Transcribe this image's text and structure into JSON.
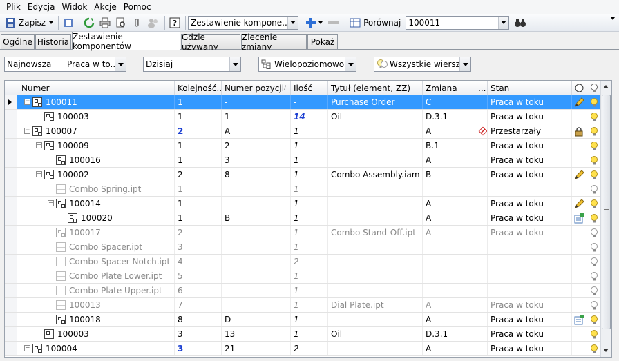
{
  "menu": [
    "Plik",
    "Edycja",
    "Widok",
    "Akcje",
    "Pomoc"
  ],
  "toolbar": {
    "save_label": "Zapisz",
    "view_combo": "Zestawienie kompone...",
    "compare_label": "Porównaj",
    "compare_value": "100011"
  },
  "tabs": [
    "Ogólne",
    "Historia",
    "Zestawienie komponentów",
    "Gdzie używany",
    "Zlecenie zmiany",
    "Pokaż"
  ],
  "filters": {
    "version": "Najnowsza",
    "status": "Praca w to...",
    "date": "Dzisiaj",
    "levels": "Wielopoziomowo",
    "rows": "Wszystkie wiersze"
  },
  "columns": [
    "Numer",
    "Kolejność...",
    "Numer pozycji",
    "Ilość",
    "Tytuł (element, ZZ)",
    "Zmiana",
    "...",
    "Stan"
  ],
  "rows": [
    {
      "level": 0,
      "exp": "−",
      "icon": "asm",
      "numer": "100011",
      "kol": "1",
      "poz": "-",
      "ilosc": "-",
      "tytul": "Purchase Order",
      "zmiana": "C",
      "stan": "Praca w toku",
      "ind": "pencil",
      "sel": true
    },
    {
      "level": 1,
      "exp": "",
      "icon": "asm",
      "numer": "100003",
      "kol": "1",
      "poz": "1",
      "ilosc": "14",
      "tytul": "Oil",
      "zmiana": "D.3.1",
      "stan": "Praca w toku",
      "ind": "",
      "qtyBlue": true
    },
    {
      "level": 0,
      "exp": "−",
      "icon": "asm",
      "numer": "100007",
      "kol": "2",
      "poz": "A",
      "ilosc": "1",
      "tytul": "",
      "zmiana": "A",
      "stan": "Przestarzały",
      "ind": "lock",
      "kolBlue": true,
      "obsolete": true
    },
    {
      "level": 1,
      "exp": "−",
      "icon": "asm",
      "numer": "100009",
      "kol": "1",
      "poz": "2",
      "ilosc": "1",
      "tytul": "",
      "zmiana": "B.1",
      "stan": "Praca w toku",
      "ind": ""
    },
    {
      "level": 2,
      "exp": "",
      "icon": "asm",
      "numer": "100016",
      "kol": "1",
      "poz": "3",
      "ilosc": "1",
      "tytul": "",
      "zmiana": "A",
      "stan": "Praca w toku",
      "ind": ""
    },
    {
      "level": 1,
      "exp": "−",
      "icon": "asm",
      "numer": "100002",
      "kol": "2",
      "poz": "8",
      "ilosc": "1",
      "tytul": "Combo Assembly.iam",
      "zmiana": "B",
      "stan": "Praca w toku",
      "ind": "pencil"
    },
    {
      "level": 2,
      "exp": "",
      "icon": "part",
      "numer": "Combo Spring.ipt",
      "kol": "1",
      "poz": "",
      "ilosc": "1",
      "tytul": "",
      "zmiana": "",
      "stan": "",
      "ind": "",
      "gray": true
    },
    {
      "level": 2,
      "exp": "−",
      "icon": "asm",
      "numer": "100014",
      "kol": "1",
      "poz": "",
      "ilosc": "1",
      "tytul": "",
      "zmiana": "A",
      "stan": "Praca w toku",
      "ind": "pencil"
    },
    {
      "level": 3,
      "exp": "",
      "icon": "asm",
      "numer": "100020",
      "kol": "1",
      "poz": "B",
      "ilosc": "1",
      "tytul": "",
      "zmiana": "A",
      "stan": "Praca w toku",
      "ind": "doc"
    },
    {
      "level": 2,
      "exp": "",
      "icon": "asmg",
      "numer": "100017",
      "kol": "2",
      "poz": "",
      "ilosc": "1",
      "tytul": "Combo Stand-Off.ipt",
      "zmiana": "A",
      "stan": "Praca w toku",
      "ind": "",
      "gray": true
    },
    {
      "level": 2,
      "exp": "",
      "icon": "part",
      "numer": "Combo Spacer.ipt",
      "kol": "3",
      "poz": "",
      "ilosc": "1",
      "tytul": "",
      "zmiana": "",
      "stan": "",
      "ind": "",
      "gray": true
    },
    {
      "level": 2,
      "exp": "",
      "icon": "part",
      "numer": "Combo Spacer Notch.ipt",
      "kol": "4",
      "poz": "",
      "ilosc": "2",
      "tytul": "",
      "zmiana": "",
      "stan": "",
      "ind": "",
      "gray": true
    },
    {
      "level": 2,
      "exp": "",
      "icon": "part",
      "numer": "Combo Plate Lower.ipt",
      "kol": "5",
      "poz": "",
      "ilosc": "1",
      "tytul": "",
      "zmiana": "",
      "stan": "",
      "ind": "",
      "gray": true
    },
    {
      "level": 2,
      "exp": "",
      "icon": "part",
      "numer": "Combo Plate Upper.ipt",
      "kol": "6",
      "poz": "",
      "ilosc": "1",
      "tytul": "",
      "zmiana": "",
      "stan": "",
      "ind": "",
      "gray": true
    },
    {
      "level": 2,
      "exp": "",
      "icon": "part",
      "numer": "100013",
      "kol": "7",
      "poz": "",
      "ilosc": "1",
      "tytul": "Dial Plate.ipt",
      "zmiana": "A",
      "stan": "Praca w toku",
      "ind": "",
      "gray": true
    },
    {
      "level": 2,
      "exp": "",
      "icon": "asm",
      "numer": "100018",
      "kol": "8",
      "poz": "D",
      "ilosc": "1",
      "tytul": "",
      "zmiana": "A",
      "stan": "Praca w toku",
      "ind": "doc"
    },
    {
      "level": 1,
      "exp": "",
      "icon": "asm",
      "numer": "100003",
      "kol": "3",
      "poz": "13",
      "ilosc": "1",
      "tytul": "Oil",
      "zmiana": "D.3.1",
      "stan": "Praca w toku",
      "ind": ""
    },
    {
      "level": 0,
      "exp": "−",
      "icon": "asm",
      "numer": "100004",
      "kol": "3",
      "poz": "21",
      "ilosc": "2",
      "tytul": "",
      "zmiana": "A",
      "stan": "Praca w toku",
      "ind": "",
      "kolBlue": true
    }
  ]
}
